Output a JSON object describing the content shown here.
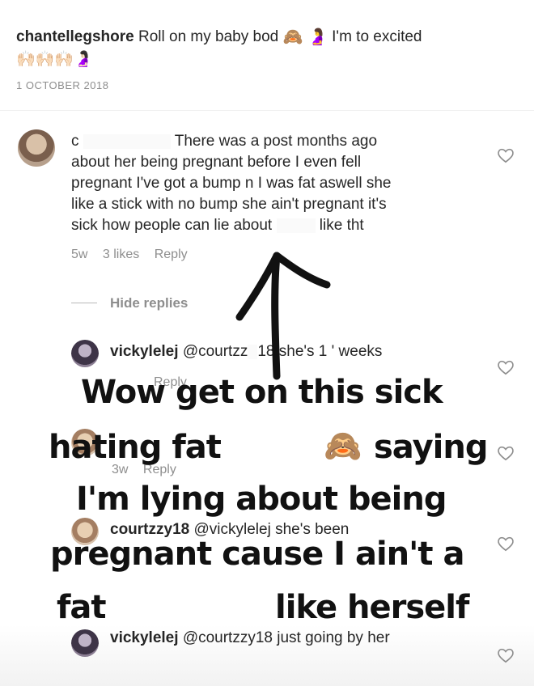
{
  "caption": {
    "username": "chantellegshore",
    "text": "Roll on my baby bod",
    "text2": "I'm to excited",
    "emojis_line1": "🙈 🤰",
    "emojis_line2": "🙌🏻🙌🏻🙌🏻🤰🏻",
    "date": "1 OCTOBER 2018"
  },
  "comment": {
    "prefix": "c",
    "line1": "There was a post months ago",
    "line2": "about her being pregnant before I even fell",
    "line3": "pregnant I've got a bump n I was fat aswell she",
    "line4": "like a stick with no bump she ain't pregnant it's",
    "line5a": "sick how people can lie about",
    "line5b": "like tht",
    "time": "5w",
    "likes": "3 likes",
    "reply": "Reply",
    "hide_replies": "Hide replies"
  },
  "replies": [
    {
      "username": "vickylelej",
      "text": "@courtzz",
      "text_tail": "18 she's 1 ' weeks",
      "time": "",
      "reply": "Reply"
    },
    {
      "username": "courtzzy18",
      "text": "",
      "time": "3w",
      "reply": "Reply"
    },
    {
      "username": "courtzzy18",
      "text": "@vickylelej she's been",
      "time": "",
      "reply": ""
    },
    {
      "username": "vickylelej",
      "text": "@courtzzy18 just going by her"
    }
  ],
  "overlay": {
    "line1": "Wow get on this sick",
    "line2a": "hating fat",
    "line2_emoji": "🙈",
    "line2b": "saying",
    "line3": "I'm lying about being",
    "line4": "pregnant cause I ain't a",
    "line5a": "fat",
    "line5b": "like herself"
  },
  "icons": {
    "heart": "heart-icon",
    "arrow": "hand-drawn-arrow"
  }
}
